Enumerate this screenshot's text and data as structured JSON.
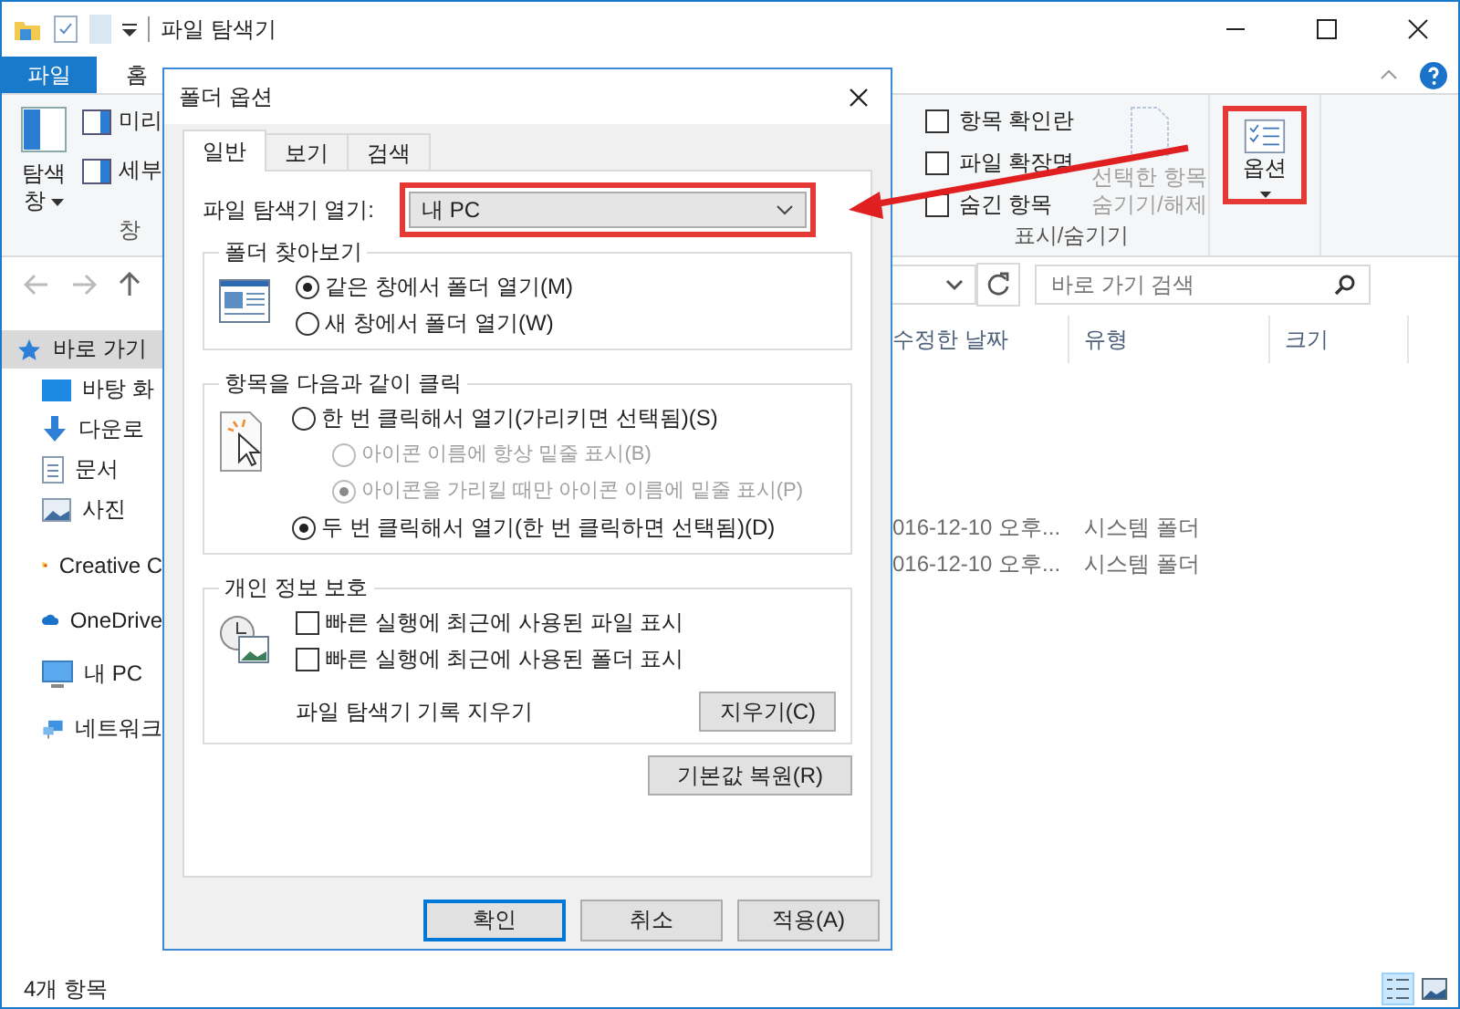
{
  "window": {
    "title": "파일 탐색기"
  },
  "ribbon_tabs": [
    {
      "label": "파일",
      "kind": "file"
    },
    {
      "label": "홈",
      "kind": "tab"
    }
  ],
  "ribbon": {
    "nav_pane": "탐색 창",
    "pane_items": [
      "미리",
      "세부"
    ],
    "pane_group_label": "창",
    "show_hide": {
      "checkboxes": [
        {
          "label": "항목 확인란",
          "checked": false
        },
        {
          "label": "파일 확장명",
          "checked": false
        },
        {
          "label": "숨긴 항목",
          "checked": false
        }
      ],
      "hide_selected": "선택한 항목 숨기기/해제",
      "label": "표시/숨기기"
    },
    "options_button": {
      "label": "옵션",
      "highlighted": true
    }
  },
  "nav": {
    "search_placeholder": "바로 가기 검색"
  },
  "sidebar": [
    {
      "label": "바로 가기",
      "kind": "star",
      "selected": true
    },
    {
      "label": "바탕 화",
      "kind": "desktop",
      "selected": false
    },
    {
      "label": "다운로",
      "kind": "download",
      "selected": false
    },
    {
      "label": "문서",
      "kind": "document",
      "selected": false
    },
    {
      "label": "사진",
      "kind": "pictures",
      "selected": false
    },
    {
      "label": "Creative C",
      "kind": "creative",
      "selected": false
    },
    {
      "label": "OneDrive",
      "kind": "cloud",
      "selected": false
    },
    {
      "label": "내 PC",
      "kind": "pc",
      "selected": false
    },
    {
      "label": "네트워크",
      "kind": "network",
      "selected": false
    }
  ],
  "columns": [
    "수정한 날짜",
    "유형",
    "크기"
  ],
  "rows": [
    {
      "modified": "016-12-10 오후...",
      "type": "시스템 폴더"
    },
    {
      "modified": "016-12-10 오후...",
      "type": "시스템 폴더"
    }
  ],
  "status_bar": {
    "text": "4개 항목",
    "views": [
      {
        "kind": "details",
        "selected": true
      },
      {
        "kind": "thumbnails",
        "selected": false
      }
    ]
  },
  "dialog": {
    "title": "폴더 옵션",
    "tabs": [
      {
        "label": "일반",
        "selected": true
      },
      {
        "label": "보기",
        "selected": false
      },
      {
        "label": "검색",
        "selected": false
      }
    ],
    "open_label": "파일 탐색기 열기:",
    "open_value": "내 PC",
    "open_highlighted": true,
    "browse": {
      "title": "폴더 찾아보기",
      "options": [
        {
          "label": "같은 창에서 폴더 열기(M)",
          "selected": true
        },
        {
          "label": "새 창에서 폴더 열기(W)",
          "selected": false
        }
      ]
    },
    "click": {
      "title": "항목을 다음과 같이 클릭",
      "options": [
        {
          "label": "한 번 클릭해서 열기(가리키면 선택됨)(S)",
          "selected": false,
          "disabled": false,
          "children": [
            {
              "label": "아이콘 이름에 항상 밑줄 표시(B)",
              "selected": false,
              "disabled": true
            },
            {
              "label": "아이콘을 가리킬 때만 아이콘 이름에 밑줄 표시(P)",
              "selected": true,
              "disabled": true
            }
          ]
        },
        {
          "label": "두 번 클릭해서 열기(한 번 클릭하면 선택됨)(D)",
          "selected": true,
          "disabled": false
        }
      ]
    },
    "privacy": {
      "title": "개인 정보 보호",
      "checkboxes": [
        {
          "label": "빠른 실행에 최근에 사용된 파일 표시",
          "checked": false
        },
        {
          "label": "빠른 실행에 최근에 사용된 폴더 표시",
          "checked": false
        }
      ],
      "clear_label": "파일 탐색기 기록 지우기",
      "clear_button": "지우기(C)"
    },
    "restore_button": "기본값 복원(R)",
    "buttons": [
      {
        "label": "확인",
        "default": true
      },
      {
        "label": "취소",
        "default": false
      },
      {
        "label": "적용(A)",
        "default": false
      }
    ]
  }
}
